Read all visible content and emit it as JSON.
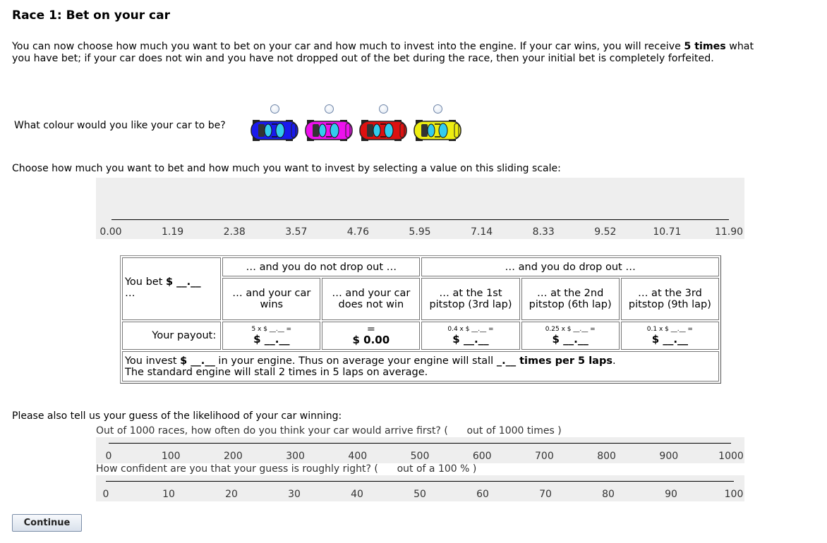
{
  "title": "Race 1: Bet on your car",
  "intro": {
    "line1_pre": "You can now choose how much you want to bet on your car and how much to invest into the engine. If your car wins, you will receive ",
    "line1_bold": "5 times",
    "line1_post": " what",
    "line2": "you have bet; if your car does not win and you have not dropped out of the bet during the race, then your initial bet is completely forfeited."
  },
  "colour_question": "What colour would you like your car to be?",
  "car_options": [
    {
      "name": "blue",
      "color": "#1a1aee"
    },
    {
      "name": "magenta",
      "color": "#ee11ee"
    },
    {
      "name": "red",
      "color": "#dd1111"
    },
    {
      "name": "yellow",
      "color": "#eeee11"
    }
  ],
  "bet_instruction": "Choose how much you want to bet and how much you want to invest by selecting a value on this sliding scale:",
  "bet_slider": {
    "ticks": [
      "0.00",
      "1.19",
      "2.38",
      "3.57",
      "4.76",
      "5.95",
      "7.14",
      "8.33",
      "9.52",
      "10.71",
      "11.90"
    ]
  },
  "table": {
    "you_bet_pre": "You bet ",
    "you_bet_bold": "$ __.__",
    "you_bet_post": "…",
    "header_not_drop": "… and you do not drop out …",
    "header_drop": "… and you do drop out …",
    "col_wins": "… and your car wins",
    "col_not_win": "… and your car does not win",
    "col_pit1": "… at the 1st pitstop (3rd lap)",
    "col_pit2": "… at the 2nd pitstop (6th lap)",
    "col_pit3": "… at the 3rd pitstop (9th lap)",
    "payout_label": "Your payout:",
    "payouts": [
      {
        "formula": "5 x $ __.__ =",
        "value": "$ __.__"
      },
      {
        "formula": "=",
        "value": "$ 0.00"
      },
      {
        "formula": "0.4 x $ __.__ =",
        "value": "$ __.__"
      },
      {
        "formula": "0.25 x $ __.__ =",
        "value": "$ __.__"
      },
      {
        "formula": "0.1 x $ __.__ =",
        "value": "$ __.__"
      }
    ],
    "invest_pre": "You invest ",
    "invest_bold": "$ __.__",
    "invest_mid": " in your engine. Thus on average your engine will stall ",
    "invest_bold2": "_.__ times per 5 laps",
    "invest_post": ".",
    "standard_engine": "The standard engine will stall 2 times in 5 laps on average."
  },
  "guess_heading": "Please also tell us your guess of the likelihood of your car winning:",
  "guess_slider": {
    "question": "Out of 1000 races, how often do you think your car would arrive first? (      out of 1000 times )",
    "ticks": [
      "0",
      "100",
      "200",
      "300",
      "400",
      "500",
      "600",
      "700",
      "800",
      "900",
      "1000"
    ]
  },
  "confidence_slider": {
    "question": "How confident are you that your guess is roughly right? (      out of a 100 % )",
    "ticks": [
      "0",
      "10",
      "20",
      "30",
      "40",
      "50",
      "60",
      "70",
      "80",
      "90",
      "100"
    ]
  },
  "continue_label": "Continue"
}
